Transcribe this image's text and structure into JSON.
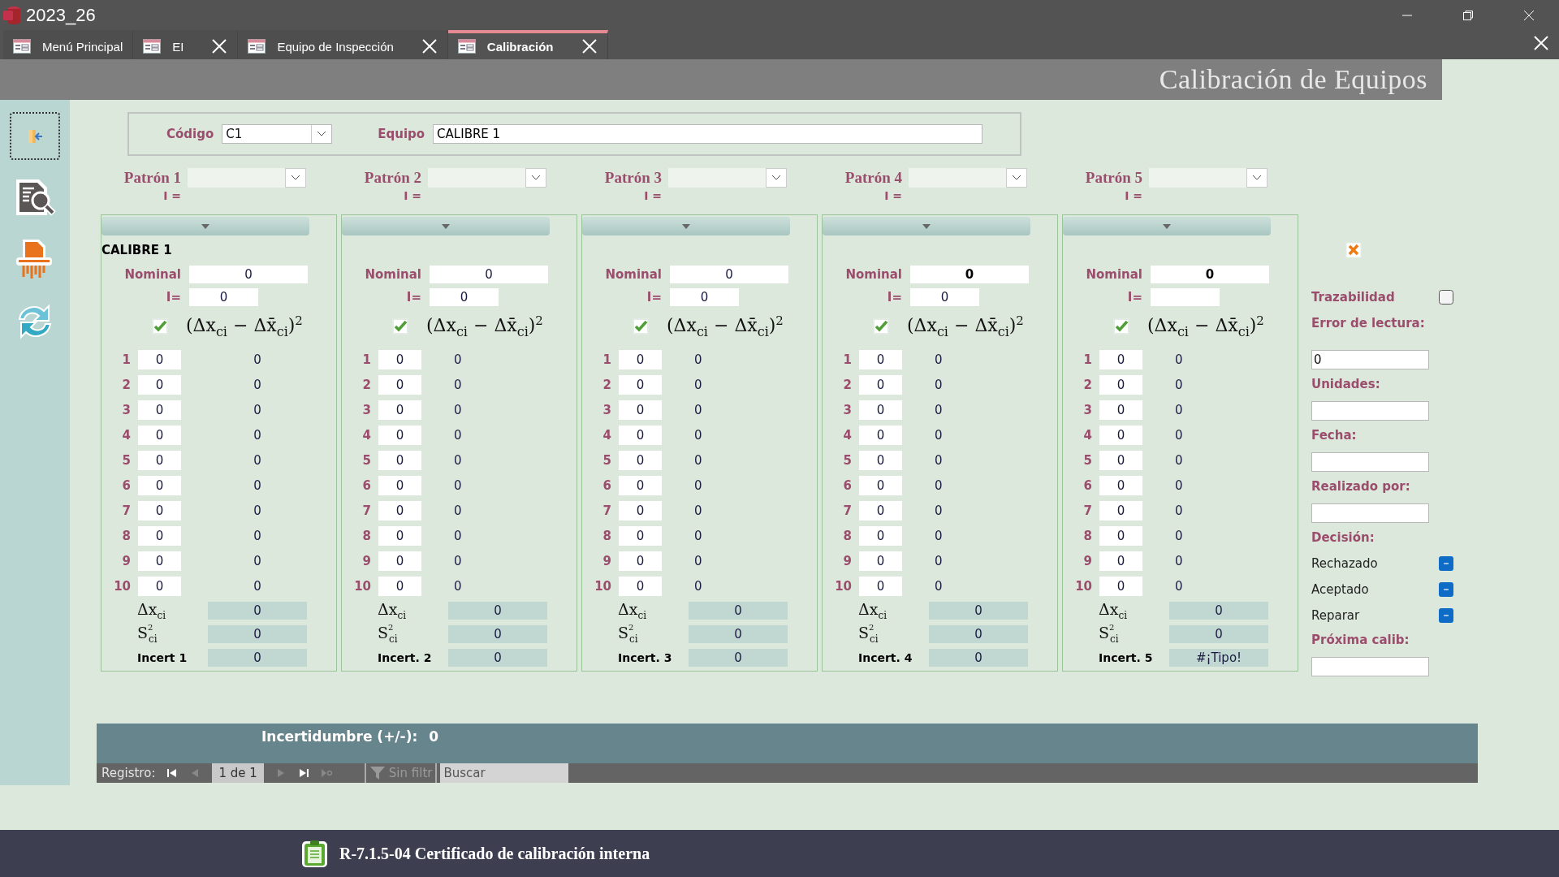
{
  "window": {
    "title": "2023_26"
  },
  "tabs": [
    {
      "label": "Menú Principal",
      "selected": false,
      "closable": false
    },
    {
      "label": "EI",
      "selected": false,
      "closable": true
    },
    {
      "label": "Equipo de Inspección",
      "selected": false,
      "closable": true
    },
    {
      "label": "Calibración",
      "selected": true,
      "closable": true
    }
  ],
  "header": {
    "title": "Calibración de Equipos"
  },
  "record": {
    "codigo": {
      "label": "Código",
      "value": "C1"
    },
    "equipo": {
      "label": "Equipo",
      "value": "CALIBRE 1"
    }
  },
  "patrones": [
    {
      "label": "Patrón 1",
      "i_label": "I ="
    },
    {
      "label": "Patrón 2",
      "i_label": "I ="
    },
    {
      "label": "Patrón 3",
      "i_label": "I ="
    },
    {
      "label": "Patrón 4",
      "i_label": "I ="
    },
    {
      "label": "Patrón 5",
      "i_label": "I ="
    }
  ],
  "columns": [
    {
      "name": "CALIBRE 1",
      "nominal": {
        "label": "Nominal",
        "value": "0",
        "bold": false
      },
      "i": {
        "label": "I=",
        "value": "0"
      },
      "checked": true,
      "formula": "(Δx$_{ci}$ − Δx̄$_{ci}$)$^{2}$",
      "rows": [
        {
          "number": "1",
          "reading": "0",
          "result": "0"
        },
        {
          "number": "2",
          "reading": "0",
          "result": "0"
        },
        {
          "number": "3",
          "reading": "0",
          "result": "0"
        },
        {
          "number": "4",
          "reading": "0",
          "result": "0"
        },
        {
          "number": "5",
          "reading": "0",
          "result": "0"
        },
        {
          "number": "6",
          "reading": "0",
          "result": "0"
        },
        {
          "number": "7",
          "reading": "0",
          "result": "0"
        },
        {
          "number": "8",
          "reading": "0",
          "result": "0"
        },
        {
          "number": "9",
          "reading": "0",
          "result": "0"
        },
        {
          "number": "10",
          "reading": "0",
          "result": "0"
        }
      ],
      "delta": {
        "label": "Δx$_{ci}$",
        "value": "0"
      },
      "variance": {
        "label": "S$^{2}$$_{ci}$",
        "value": "0"
      },
      "uncertainty": {
        "label": "Incert 1",
        "value": "0"
      }
    },
    {
      "nominal": {
        "label": "Nominal",
        "value": "0",
        "bold": false
      },
      "i": {
        "label": "I=",
        "value": "0"
      },
      "checked": true,
      "formula": "(Δx$_{ci}$ − Δx̄$_{ci}$)$^{2}$",
      "rows": [
        {
          "number": "1",
          "reading": "0",
          "result": "0"
        },
        {
          "number": "2",
          "reading": "0",
          "result": "0"
        },
        {
          "number": "3",
          "reading": "0",
          "result": "0"
        },
        {
          "number": "4",
          "reading": "0",
          "result": "0"
        },
        {
          "number": "5",
          "reading": "0",
          "result": "0"
        },
        {
          "number": "6",
          "reading": "0",
          "result": "0"
        },
        {
          "number": "7",
          "reading": "0",
          "result": "0"
        },
        {
          "number": "8",
          "reading": "0",
          "result": "0"
        },
        {
          "number": "9",
          "reading": "0",
          "result": "0"
        },
        {
          "number": "10",
          "reading": "0",
          "result": "0"
        }
      ],
      "delta": {
        "label": "Δx$_{ci}$",
        "value": "0"
      },
      "variance": {
        "label": "S$^{2}$$_{ci}$",
        "value": "0"
      },
      "uncertainty": {
        "label": "Incert. 2",
        "value": "0"
      }
    },
    {
      "nominal": {
        "label": "Nominal",
        "value": "0",
        "bold": false
      },
      "i": {
        "label": "I=",
        "value": "0"
      },
      "checked": true,
      "formula": "(Δx$_{ci}$ − Δx̄$_{ci}$)$^{2}$",
      "rows": [
        {
          "number": "1",
          "reading": "0",
          "result": "0"
        },
        {
          "number": "2",
          "reading": "0",
          "result": "0"
        },
        {
          "number": "3",
          "reading": "0",
          "result": "0"
        },
        {
          "number": "4",
          "reading": "0",
          "result": "0"
        },
        {
          "number": "5",
          "reading": "0",
          "result": "0"
        },
        {
          "number": "6",
          "reading": "0",
          "result": "0"
        },
        {
          "number": "7",
          "reading": "0",
          "result": "0"
        },
        {
          "number": "8",
          "reading": "0",
          "result": "0"
        },
        {
          "number": "9",
          "reading": "0",
          "result": "0"
        },
        {
          "number": "10",
          "reading": "0",
          "result": "0"
        }
      ],
      "delta": {
        "label": "Δx$_{ci}$",
        "value": "0"
      },
      "variance": {
        "label": "S$^{2}$$_{ci}$",
        "value": "0"
      },
      "uncertainty": {
        "label": "Incert. 3",
        "value": "0"
      }
    },
    {
      "nominal": {
        "label": "Nominal",
        "value": "0",
        "bold": true
      },
      "i": {
        "label": "I=",
        "value": "0"
      },
      "checked": true,
      "formula": "(Δx$_{ci}$ − Δx̄$_{ci}$)$^{2}$",
      "rows": [
        {
          "number": "1",
          "reading": "0",
          "result": "0"
        },
        {
          "number": "2",
          "reading": "0",
          "result": "0"
        },
        {
          "number": "3",
          "reading": "0",
          "result": "0"
        },
        {
          "number": "4",
          "reading": "0",
          "result": "0"
        },
        {
          "number": "5",
          "reading": "0",
          "result": "0"
        },
        {
          "number": "6",
          "reading": "0",
          "result": "0"
        },
        {
          "number": "7",
          "reading": "0",
          "result": "0"
        },
        {
          "number": "8",
          "reading": "0",
          "result": "0"
        },
        {
          "number": "9",
          "reading": "0",
          "result": "0"
        },
        {
          "number": "10",
          "reading": "0",
          "result": "0"
        }
      ],
      "delta": {
        "label": "Δx$_{ci}$",
        "value": "0"
      },
      "variance": {
        "label": "S$^{2}$$_{ci}$",
        "value": "0"
      },
      "uncertainty": {
        "label": "Incert. 4",
        "value": "0"
      }
    },
    {
      "nominal": {
        "label": "Nominal",
        "value": "0",
        "bold": true
      },
      "i": {
        "label": "I="
      },
      "checked": true,
      "formula": "(Δx$_{ci}$ − Δx̄$_{ci}$)$^{2}$",
      "rows": [
        {
          "number": "1",
          "reading": "0",
          "result": "0"
        },
        {
          "number": "2",
          "reading": "0",
          "result": "0"
        },
        {
          "number": "3",
          "reading": "0",
          "result": "0"
        },
        {
          "number": "4",
          "reading": "0",
          "result": "0"
        },
        {
          "number": "5",
          "reading": "0",
          "result": "0"
        },
        {
          "number": "6",
          "reading": "0",
          "result": "0"
        },
        {
          "number": "7",
          "reading": "0",
          "result": "0"
        },
        {
          "number": "8",
          "reading": "0",
          "result": "0"
        },
        {
          "number": "9",
          "reading": "0",
          "result": "0"
        },
        {
          "number": "10",
          "reading": "0",
          "result": "0"
        }
      ],
      "delta": {
        "label": "Δx$_{ci}$",
        "value": "0"
      },
      "variance": {
        "label": "S$^{2}$$_{ci}$",
        "value": "0"
      },
      "uncertainty": {
        "label": "Incert. 5",
        "value": "#¡Tipo!"
      }
    }
  ],
  "side": {
    "trazabilidad": {
      "label": "Trazabilidad",
      "checked": false
    },
    "fields": [
      {
        "label": "Error de lectura:",
        "value": "0"
      },
      {
        "label": "Unidades:"
      },
      {
        "label": "Fecha:"
      },
      {
        "label": "Realizado por:"
      }
    ],
    "decision": {
      "label": "Decisión:",
      "options": [
        {
          "label": "Rechazado",
          "indeterminate": true
        },
        {
          "label": "Aceptado",
          "indeterminate": true
        },
        {
          "label": "Reparar",
          "indeterminate": true
        }
      ]
    },
    "next": {
      "label": "Próxima calib:"
    }
  },
  "summary": {
    "label": "Incertidumbre (+/-):",
    "value": "0"
  },
  "navigation": {
    "label": "Registro:",
    "position": "1 de 1",
    "filter": "Sin filtr",
    "search_placeholder": "Buscar"
  },
  "footer": {
    "title": "R-7.1.5-04 Certificado de calibración interna"
  }
}
